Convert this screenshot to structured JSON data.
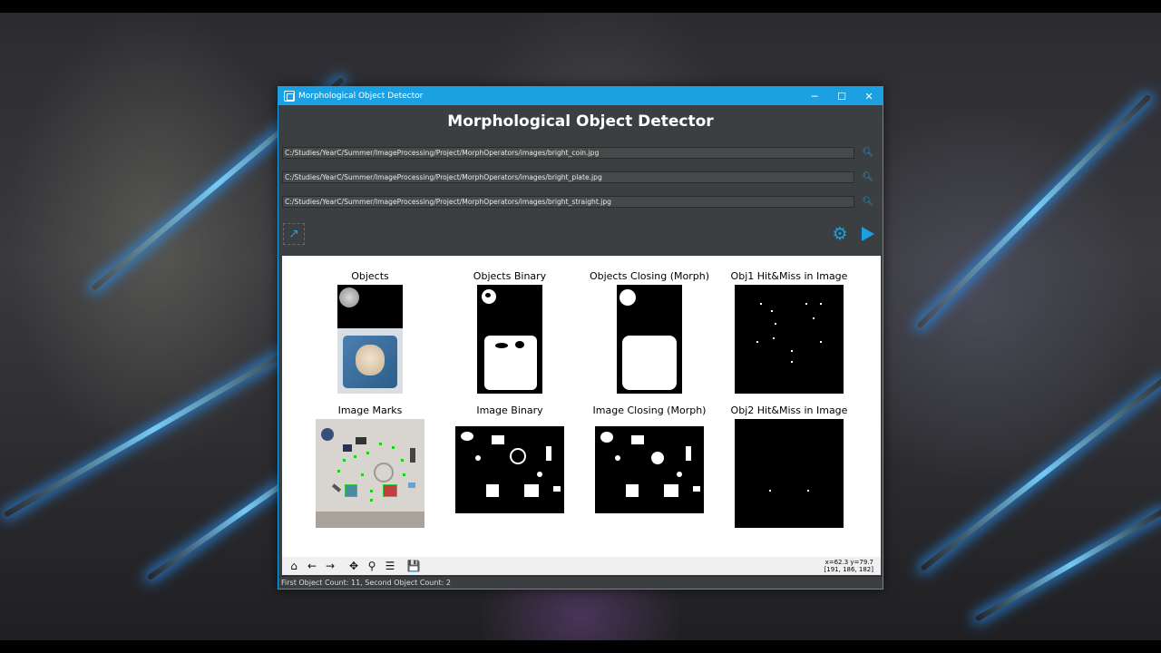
{
  "window": {
    "title": "Morphological Object Detector",
    "controls": {
      "minimize": "─",
      "maximize": "☐",
      "close": "✕"
    }
  },
  "header": {
    "title": "Morphological Object Detector"
  },
  "paths": [
    "C:/Studies/YearC/Summer/ImageProcessing/Project/MorphOperators/images/bright_coin.jpg",
    "C:/Studies/YearC/Summer/ImageProcessing/Project/MorphOperators/images/bright_plate.jpg",
    "C:/Studies/YearC/Summer/ImageProcessing/Project/MorphOperators/images/bright_straight.jpg"
  ],
  "icons": {
    "search": "search-icon",
    "export": "external-link-icon",
    "settings": "gear-icon",
    "run": "play-icon"
  },
  "plots": {
    "objects": "Objects",
    "objects_binary": "Objects Binary",
    "objects_closing": "Objects Closing (Morph)",
    "obj1_hitmiss": "Obj1 Hit&Miss in Image",
    "image_marks": "Image Marks",
    "image_binary": "Image Binary",
    "image_closing": "Image Closing (Morph)",
    "obj2_hitmiss": "Obj2 Hit&Miss in Image"
  },
  "toolbar": {
    "home": "⌂",
    "back": "←",
    "forward": "→",
    "pan": "✥",
    "zoom": "⚲",
    "configure": "☰",
    "save": "💾",
    "coords_line1": "x=62.3 y=79.7",
    "coords_line2": "[191, 186, 182]"
  },
  "status": {
    "text": "First Object Count: 11,  Second Object Count: 2"
  },
  "colors": {
    "accent": "#1ba1e2",
    "window_bg": "#3c3f41",
    "field_bg": "#45494a"
  }
}
